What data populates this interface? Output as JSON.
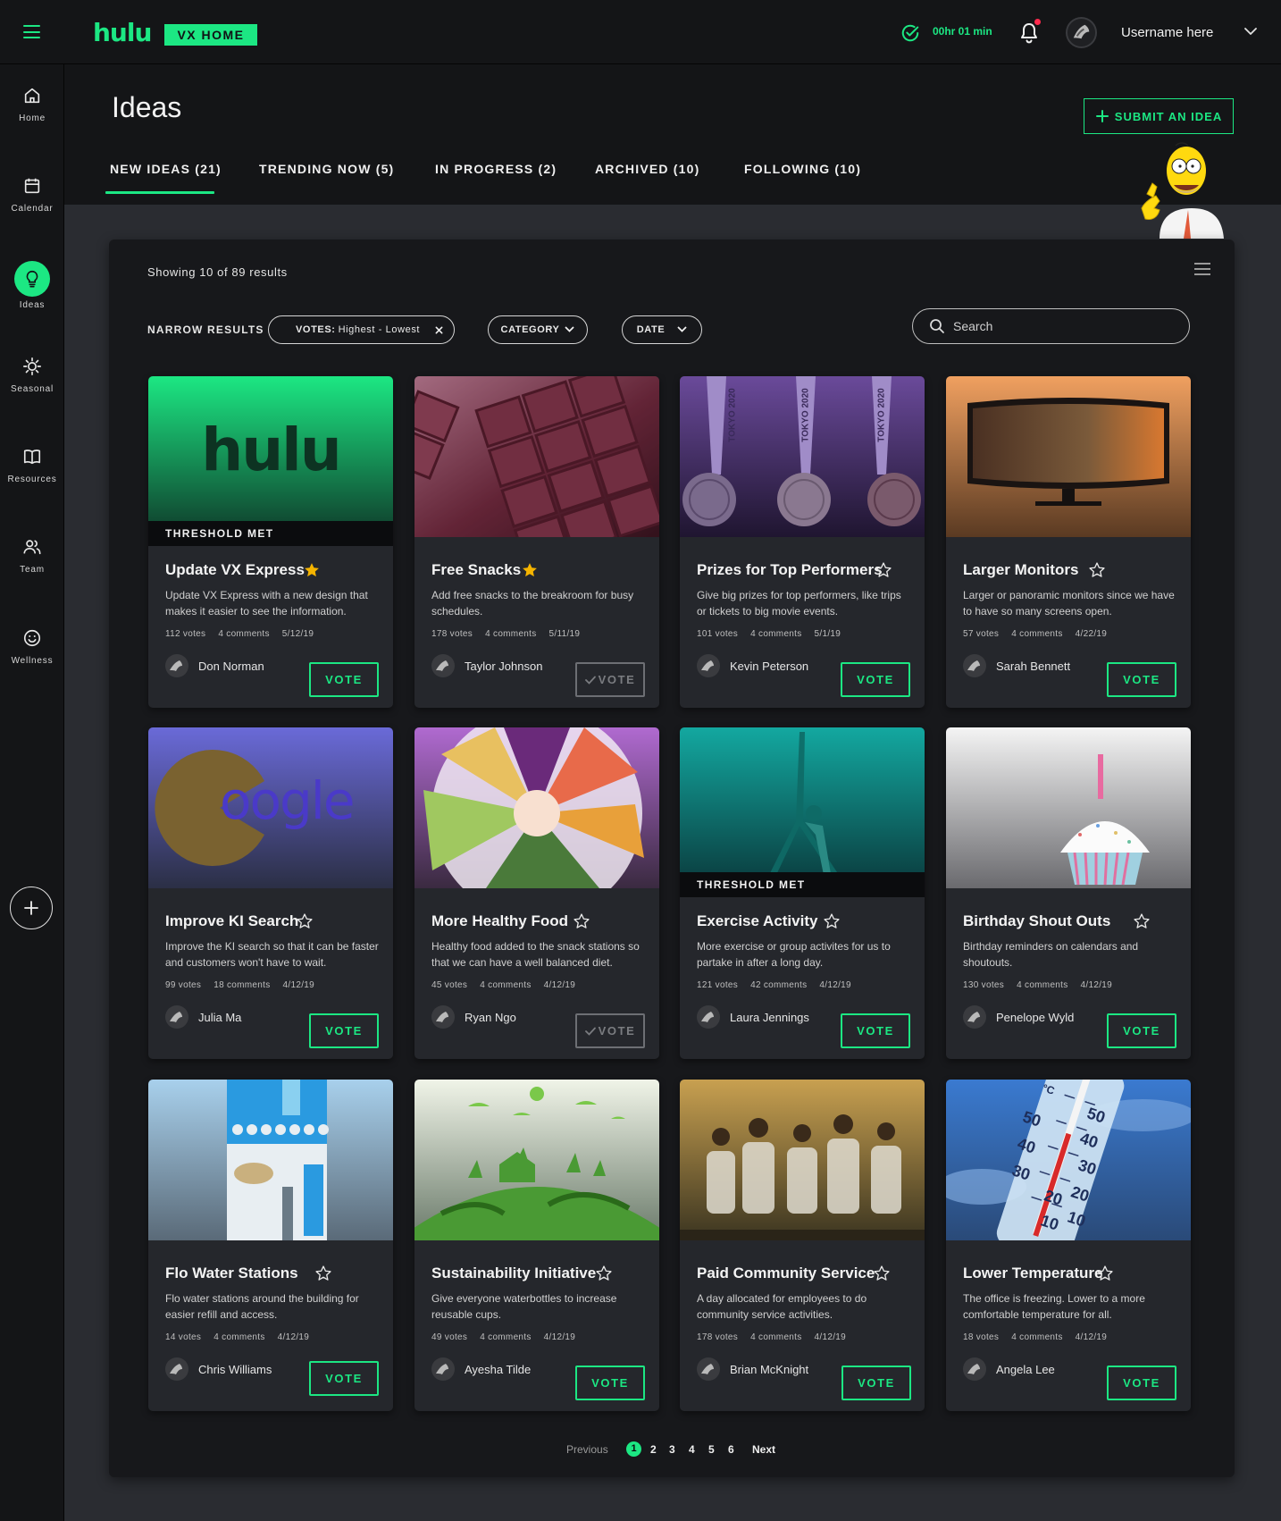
{
  "app": {
    "logo": "hulu",
    "badge": "VX HOME",
    "timer": "00hr 01 min",
    "username": "Username here"
  },
  "sidebar": {
    "items": [
      {
        "label": "Home",
        "icon": "home-icon"
      },
      {
        "label": "Calendar",
        "icon": "calendar-icon"
      },
      {
        "label": "Ideas",
        "icon": "lightbulb-icon",
        "active": true
      },
      {
        "label": "Seasonal",
        "icon": "sun-icon"
      },
      {
        "label": "Resources",
        "icon": "book-icon"
      },
      {
        "label": "Team",
        "icon": "team-icon"
      },
      {
        "label": "Wellness",
        "icon": "smiley-icon"
      }
    ]
  },
  "page": {
    "title": "Ideas",
    "submit_label": "SUBMIT AN IDEA",
    "tabs": [
      {
        "label": "NEW IDEAS (21)",
        "active": true
      },
      {
        "label": "TRENDING NOW (5)"
      },
      {
        "label": "IN PROGRESS (2)"
      },
      {
        "label": "ARCHIVED (10)"
      },
      {
        "label": "FOLLOWING (10)"
      }
    ]
  },
  "results": {
    "showing": "Showing 10 of 89 results",
    "narrow_label": "NARROW RESULTS",
    "votes_filter_key": "VOTES:",
    "votes_filter_value": "Highest - Lowest",
    "category_label": "CATEGORY",
    "date_label": "DATE",
    "search_placeholder": "Search"
  },
  "cards": [
    {
      "title": "Update VX Express",
      "starred": true,
      "threshold": "THRESHOLD MET",
      "desc": "Update VX Express with a new design that makes it easier to see the information.",
      "votes": "112 votes",
      "comments": "4 comments",
      "date": "5/12/19",
      "author": "Don Norman",
      "vote_label": "VOTE",
      "voted": false
    },
    {
      "title": "Free Snacks",
      "starred": true,
      "desc": "Add free snacks to the breakroom for busy schedules.",
      "votes": "178 votes",
      "comments": "4 comments",
      "date": "5/11/19",
      "author": "Taylor Johnson",
      "vote_label": "VOTE",
      "voted": true
    },
    {
      "title": "Prizes for Top Performers",
      "starred": false,
      "desc": "Give big prizes for top performers, like trips or tickets to big movie events.",
      "votes": "101 votes",
      "comments": "4 comments",
      "date": "5/1/19",
      "author": "Kevin Peterson",
      "vote_label": "VOTE",
      "voted": false,
      "img_text": "TOKYO 2020"
    },
    {
      "title": "Larger Monitors",
      "starred": false,
      "desc": "Larger or panoramic monitors since we have to have so many screens open.",
      "votes": "57 votes",
      "comments": "4 comments",
      "date": "4/22/19",
      "author": "Sarah Bennett",
      "vote_label": "VOTE",
      "voted": false
    },
    {
      "title": "Improve KI Search",
      "starred": false,
      "desc": "Improve the KI search so that it can be faster and customers won't have to wait.",
      "votes": "99 votes",
      "comments": "18 comments",
      "date": "4/12/19",
      "author": "Julia Ma",
      "vote_label": "VOTE",
      "voted": false,
      "img_text": "oogle"
    },
    {
      "title": "More Healthy Food",
      "starred": false,
      "desc": "Healthy food added to the snack stations so that we can have a well balanced diet.",
      "votes": "45 votes",
      "comments": "4 comments",
      "date": "4/12/19",
      "author": "Ryan Ngo",
      "vote_label": "VOTE",
      "voted": true
    },
    {
      "title": "Exercise Activity",
      "starred": false,
      "threshold": "THRESHOLD MET",
      "desc": "More exercise or group activites for us to partake in after a long day.",
      "votes": "121 votes",
      "comments": "42 comments",
      "date": "4/12/19",
      "author": "Laura Jennings",
      "vote_label": "VOTE",
      "voted": false
    },
    {
      "title": "Birthday Shout Outs",
      "starred": false,
      "desc": "Birthday reminders on calendars and shoutouts.",
      "votes": "130 votes",
      "comments": "4 comments",
      "date": "4/12/19",
      "author": "Penelope Wyld",
      "vote_label": "VOTE",
      "voted": false
    },
    {
      "title": "Flo Water Stations",
      "starred": false,
      "desc": "Flo water stations around the building for easier refill and access.",
      "votes": "14 votes",
      "comments": "4 comments",
      "date": "4/12/19",
      "author": "Chris Williams",
      "vote_label": "VOTE",
      "voted": false
    },
    {
      "title": "Sustainability Initiative",
      "starred": false,
      "desc": "Give everyone waterbottles to increase reusable cups.",
      "votes": "49 votes",
      "comments": "4 comments",
      "date": "4/12/19",
      "author": "Ayesha Tilde",
      "vote_label": "VOTE",
      "voted": false
    },
    {
      "title": "Paid Community Service",
      "starred": false,
      "desc": "A day allocated for employees to do community service activities.",
      "votes": "178 votes",
      "comments": "4 comments",
      "date": "4/12/19",
      "author": "Brian McKnight",
      "vote_label": "VOTE",
      "voted": false
    },
    {
      "title": "Lower Temperature",
      "starred": false,
      "desc": "The office is freezing. Lower to a more comfortable temperature for all.",
      "votes": "18 votes",
      "comments": "4 comments",
      "date": "4/12/19",
      "author": "Angela Lee",
      "vote_label": "VOTE",
      "voted": false,
      "img_text": [
        "50",
        "40",
        "30",
        "20",
        "10",
        "°C"
      ]
    }
  ],
  "pagination": {
    "prev": "Previous",
    "pages": [
      "1",
      "2",
      "3",
      "4",
      "5",
      "6"
    ],
    "current": "1",
    "next": "Next"
  },
  "colors": {
    "accent": "#1ce783",
    "background": "#2a2c31",
    "panel": "#17181b",
    "card": "#25272c",
    "chrome": "#141517"
  }
}
